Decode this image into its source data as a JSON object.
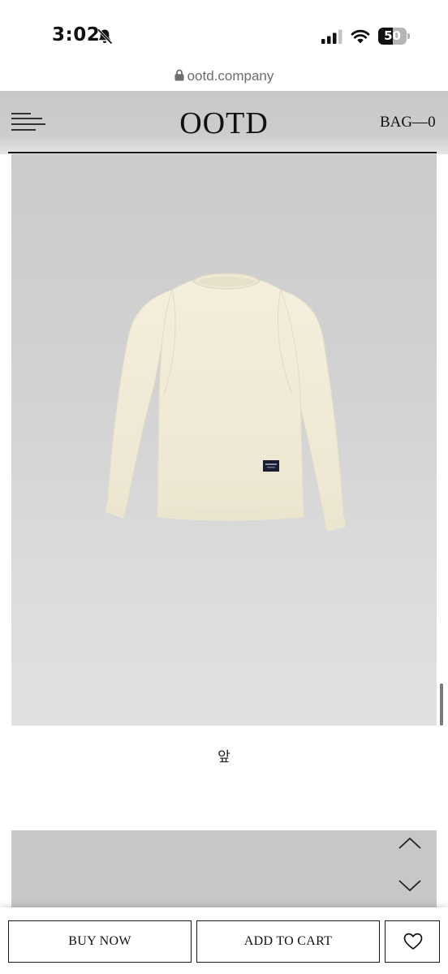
{
  "status_bar": {
    "time": "3:02",
    "battery_level": "50",
    "battery_fraction": 0.5,
    "icons": [
      "bell-muted-icon",
      "signal-icon",
      "wifi-icon",
      "battery-icon"
    ]
  },
  "browser": {
    "url": "ootd.company",
    "icons": [
      "lock-icon"
    ]
  },
  "header": {
    "brand": "OOTD",
    "bag_label": "BAG",
    "bag_separator": "—",
    "bag_count": "0",
    "icons": [
      "menu-icon"
    ]
  },
  "product": {
    "image_caption": "앞",
    "image_colors": {
      "background": "#cfcfcf",
      "garment": "#f3eedc",
      "patch": "#1b1e2e"
    }
  },
  "gallery": {
    "icons": [
      "chevron-up-icon",
      "chevron-down-icon"
    ]
  },
  "actions": {
    "buy_now_label": "BUY NOW",
    "add_to_cart_label": "ADD TO CART",
    "icons": [
      "heart-icon"
    ]
  },
  "colors": {
    "header_bg": "#cbcbcb",
    "text": "#111111",
    "url_text": "#6d6d6d"
  }
}
